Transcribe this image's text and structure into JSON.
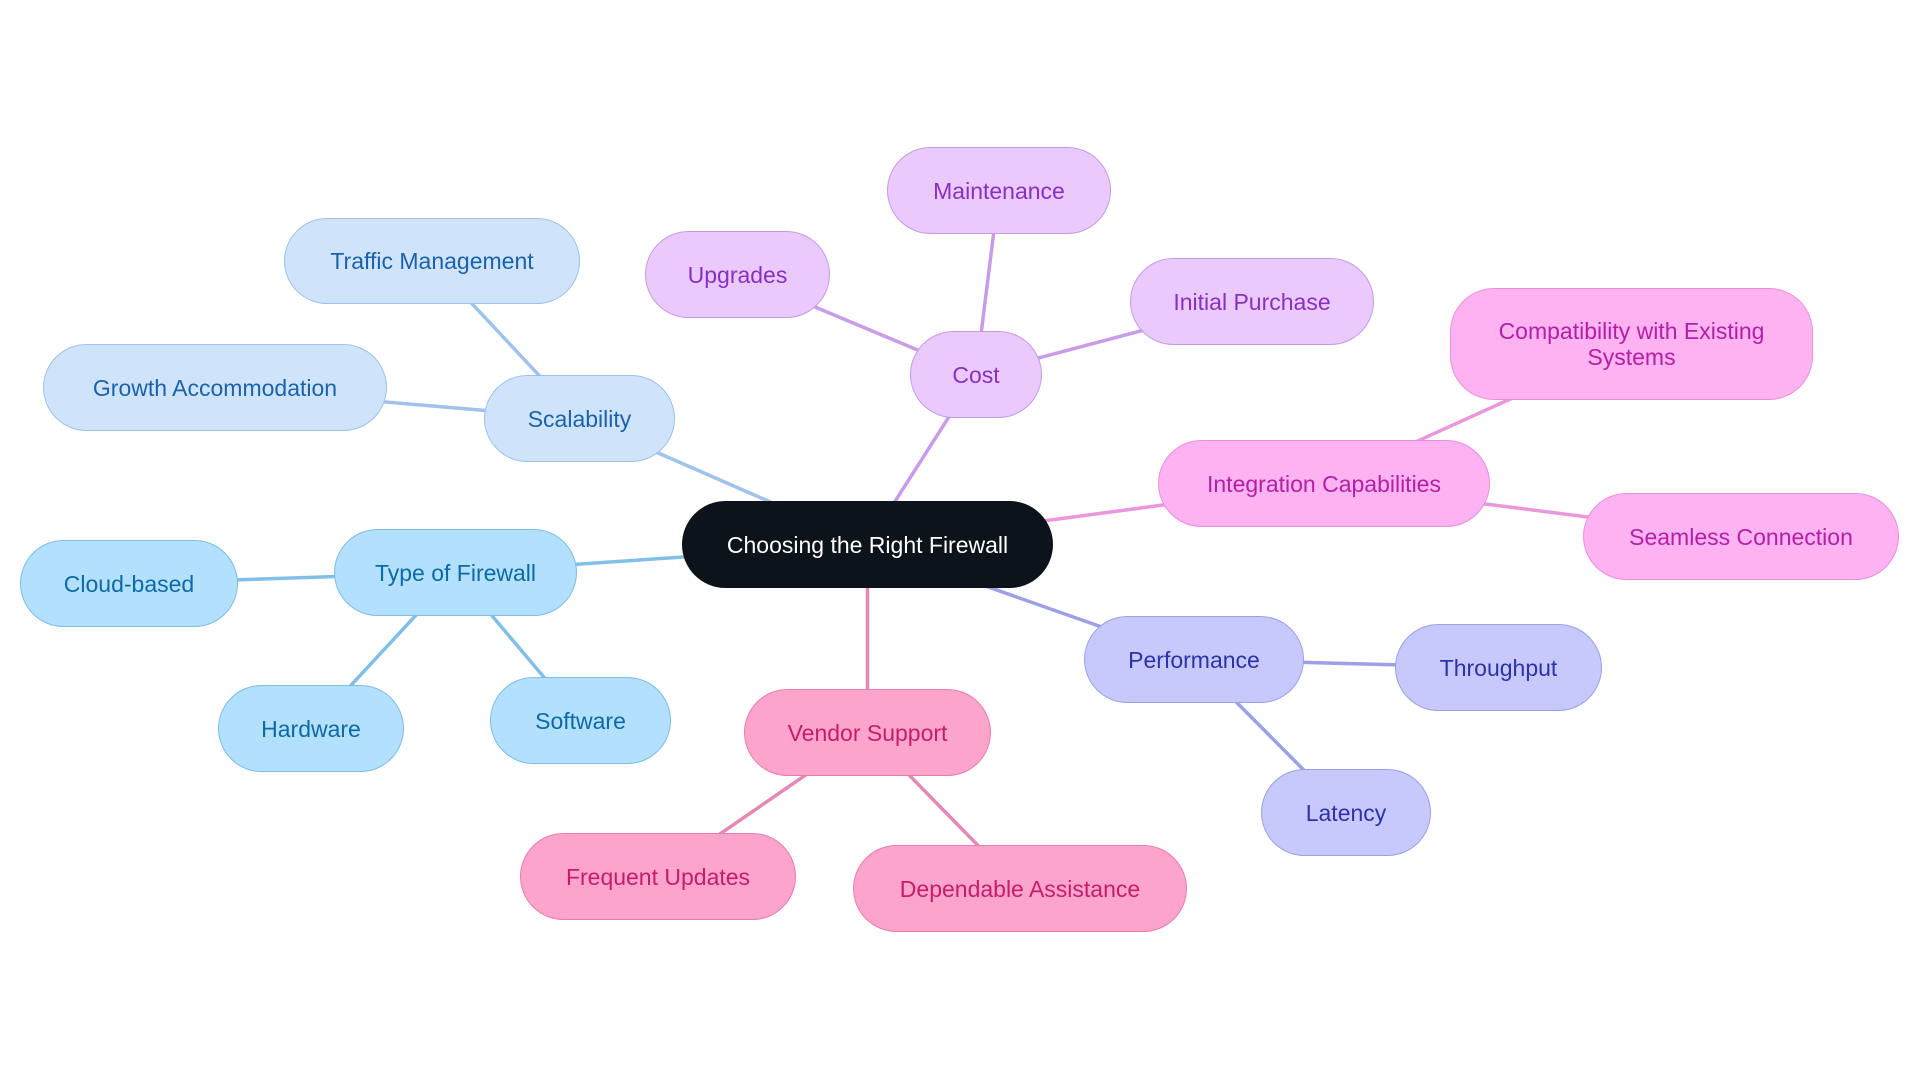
{
  "diagram": {
    "type": "mind-map",
    "root": {
      "id": "root",
      "label": "Choosing the Right Firewall"
    },
    "branches": [
      {
        "id": "type",
        "label": "Type of Firewall",
        "theme": "b-type",
        "line_color": "#80bfe8",
        "children": [
          {
            "id": "cloud",
            "label": "Cloud-based"
          },
          {
            "id": "hardware",
            "label": "Hardware"
          },
          {
            "id": "software",
            "label": "Software"
          }
        ]
      },
      {
        "id": "scale",
        "label": "Scalability",
        "theme": "b-scale",
        "line_color": "#9fc3ea",
        "children": [
          {
            "id": "traffic",
            "label": "Traffic Management"
          },
          {
            "id": "growth",
            "label": "Growth Accommodation"
          }
        ]
      },
      {
        "id": "cost",
        "label": "Cost",
        "theme": "b-cost",
        "line_color": "#c89ce8",
        "children": [
          {
            "id": "maint",
            "label": "Maintenance"
          },
          {
            "id": "upgrades",
            "label": "Upgrades"
          },
          {
            "id": "initial",
            "label": "Initial Purchase"
          }
        ]
      },
      {
        "id": "integ",
        "label": "Integration Capabilities",
        "theme": "b-integ",
        "line_color": "#ea97dc",
        "children": [
          {
            "id": "compat",
            "label": "Compatibility with Existing Systems"
          },
          {
            "id": "seamless",
            "label": "Seamless Connection"
          }
        ]
      },
      {
        "id": "perf",
        "label": "Performance",
        "theme": "b-perf",
        "line_color": "#9ca0e6",
        "children": [
          {
            "id": "throughput",
            "label": "Throughput"
          },
          {
            "id": "latency",
            "label": "Latency"
          }
        ]
      },
      {
        "id": "vendor",
        "label": "Vendor Support",
        "theme": "b-vendor",
        "line_color": "#e688b6",
        "children": [
          {
            "id": "updates",
            "label": "Frequent Updates"
          },
          {
            "id": "assist",
            "label": "Dependable Assistance"
          }
        ]
      }
    ]
  }
}
